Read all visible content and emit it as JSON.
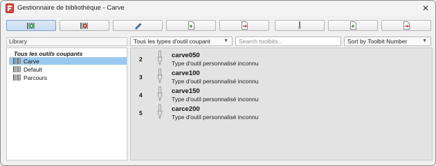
{
  "window": {
    "title": "Gestionnaire de bibliothèque - Carve",
    "close_glyph": "✕"
  },
  "toolbar": {
    "buttons": [
      {
        "name": "library-add-button",
        "icon": "library-add-icon",
        "active": true
      },
      {
        "name": "library-remove-button",
        "icon": "library-remove-icon"
      },
      {
        "name": "tool-edit-button",
        "icon": "pencil-icon"
      },
      {
        "name": "library-import-button",
        "icon": "file-import-icon"
      },
      {
        "name": "library-export-button",
        "icon": "file-export-icon"
      },
      {
        "name": "toolbit-add-button",
        "icon": "toolbit-icon"
      },
      {
        "name": "toolbit-import-button",
        "icon": "file-import-icon"
      },
      {
        "name": "toolbit-export-button",
        "icon": "file-export-icon"
      }
    ]
  },
  "library": {
    "header": "Library",
    "root_label": "Tous les outils coupants",
    "items": [
      {
        "label": "Carve",
        "selected": true
      },
      {
        "label": "Default",
        "selected": false
      },
      {
        "label": "Parcours",
        "selected": false
      }
    ]
  },
  "filters": {
    "tool_type": "Tous les types d'outil coupant",
    "search_placeholder": "Search toolbits...",
    "search_value": "",
    "sort": "Sort by Toolbit Number",
    "dropdown_glyph": "▼"
  },
  "toolbits": [
    {
      "number": "2",
      "name": "carve050",
      "type": "Type d'outil personnalisé inconnu"
    },
    {
      "number": "3",
      "name": "carve100",
      "type": "Type d'outil personnalisé inconnu"
    },
    {
      "number": "4",
      "name": "carve150",
      "type": "Type d'outil personnalisé inconnu"
    },
    {
      "number": "5",
      "name": "carce200",
      "type": "Type d'outil personnalisé inconnu"
    }
  ],
  "colors": {
    "selection": "#99c9ef",
    "accent_red": "#d63a2f",
    "accent_green": "#3a9a3a",
    "accent_blue": "#3b6db8"
  }
}
